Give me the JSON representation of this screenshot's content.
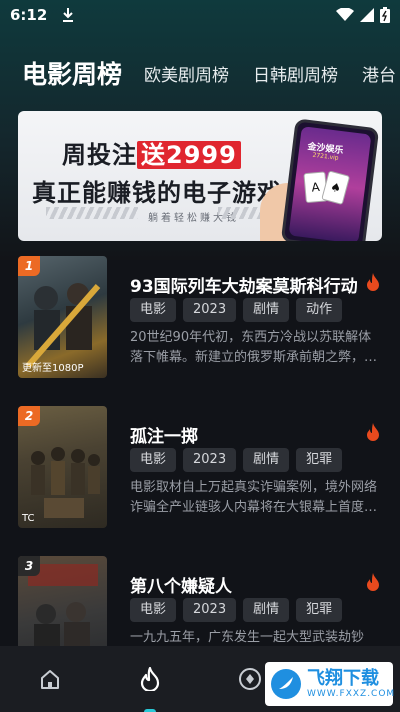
{
  "status_bar": {
    "time": "6:12"
  },
  "tabs": [
    "电影周榜",
    "欧美剧周榜",
    "日韩剧周榜",
    "港台"
  ],
  "banner": {
    "line1_prefix": "周投注",
    "line1_highlight": "送2999",
    "line2": "真正能赚钱的电子游戏",
    "line3": "躺着轻松赚大钱",
    "phone_title": "金沙娱乐",
    "phone_url": "2721.vip"
  },
  "items": [
    {
      "rank": "1",
      "title": "93国际列车大劫案莫斯科行动",
      "tags": [
        "电影",
        "2023",
        "剧情",
        "动作"
      ],
      "desc": "20世纪90年代初，东西方冷战以苏联解体落下帷幕。新建立的俄罗斯承前朝之弊，…",
      "poster_caption": "更新至1080P",
      "colors": {
        "poster_a": "#3b4a52",
        "poster_b": "#b58a3a"
      }
    },
    {
      "rank": "2",
      "title": "孤注一掷",
      "tags": [
        "电影",
        "2023",
        "剧情",
        "犯罪"
      ],
      "desc": "电影取材自上万起真实诈骗案例，境外网络诈骗全产业链骇人内幕将在大银幕上首度…",
      "poster_caption": "TC",
      "colors": {
        "poster_a": "#4a4232",
        "poster_b": "#8a7452"
      }
    },
    {
      "rank": "3",
      "title": "第八个嫌疑人",
      "tags": [
        "电影",
        "2023",
        "剧情",
        "犯罪"
      ],
      "desc": "一九九五年，广东发生一起大型武装劫钞",
      "poster_caption": "",
      "colors": {
        "poster_a": "#3a3a3a",
        "poster_b": "#7a6a5a"
      }
    }
  ],
  "nav": [
    {
      "icon": "home-icon"
    },
    {
      "icon": "fire-icon",
      "active": true
    },
    {
      "icon": "discover-icon"
    },
    {
      "icon": "profile-icon"
    }
  ],
  "watermark": {
    "main": "飞翔下载",
    "sub": "WWW.FXXZ.COM"
  },
  "colors": {
    "accent": "#29c8d6",
    "rank": "#ec6a24",
    "fire": "#e84a1e"
  }
}
